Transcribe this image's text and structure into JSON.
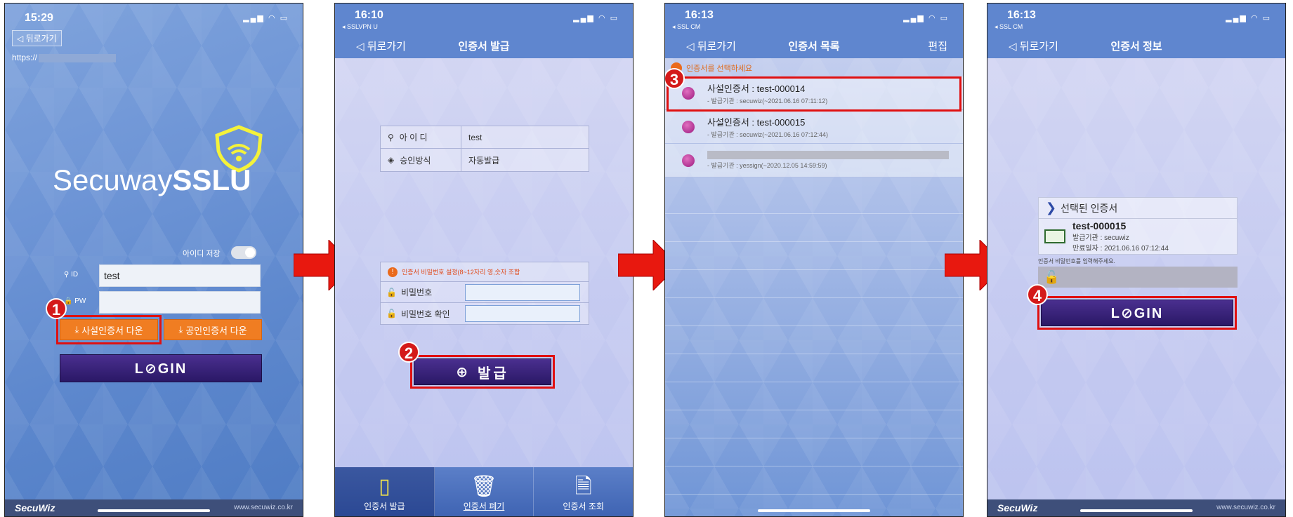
{
  "screens": {
    "login": {
      "time": "15:29",
      "back_label": "◁ 뒤로가기",
      "url_prefix": "https://",
      "logo_light": "Secuway",
      "logo_bold": "SSLU",
      "save_id_label": "아이디 저장",
      "id_label": "ID",
      "id_value": "test",
      "pw_label": "PW",
      "pw_value": "",
      "private_cert_button": "사설인증서 다운",
      "public_cert_button": "공인인증서 다운",
      "login_button": "L⊘GIN",
      "step": "1",
      "brand": "SecuWiz",
      "brand_url": "www.secuwiz.co.kr"
    },
    "issue": {
      "time": "16:10",
      "carrier": "◂ SSLVPN U",
      "back_label": "◁ 뒤로가기",
      "title": "인증서 발급",
      "id_key": "아 이 디",
      "id_value": "test",
      "approval_key": "승인방식",
      "approval_value": "자동발급",
      "notice": "인증서 비밀번호 설정(8~12자리 영,숫자 조합",
      "pw_key": "비밀번호",
      "pw_confirm_key": "비밀번호 확인",
      "issue_button": "발급",
      "step": "2",
      "tabs": [
        "인증서 발급",
        "인증서 폐기",
        "인증서 조회"
      ]
    },
    "list": {
      "time": "16:13",
      "carrier": "◂ SSL CM",
      "back_label": "◁ 뒤로가기",
      "title": "인증서 목록",
      "edit": "편집",
      "select_note": "인증서를 선택하세요",
      "step": "3",
      "certs": [
        {
          "name": "사설인증서 : test-000014",
          "issuer": "- 발급기관 : secuwiz(~2021.06.16 07:11:12)"
        },
        {
          "name": "사설인증서 : test-000015",
          "issuer": "- 발급기관 : secuwiz(~2021.06.16 07:12:44)"
        },
        {
          "name": "",
          "issuer": "- 발급기관 : yessign(~2020.12.05 14:59:59)"
        }
      ]
    },
    "info": {
      "time": "16:13",
      "carrier": "◂ SSL CM",
      "back_label": "◁ 뒤로가기",
      "title": "인증서 정보",
      "selected_header": "선택된 인증서",
      "cert_name": "test-000015",
      "cert_issuer": "발급기관 : secuwiz",
      "cert_expiry": "만료일자 : 2021.06.16 07:12:44",
      "pw_hint": "인증서 비밀번호를 입력해주세요.",
      "login_button": "L⊘GIN",
      "step": "4",
      "brand": "SecuWiz",
      "brand_url": "www.secuwiz.co.kr"
    }
  },
  "colors": {
    "highlight": "#e01010",
    "login_button": "#2a1866",
    "orange_button": "#f07d22",
    "arrow": "#e8180f"
  }
}
